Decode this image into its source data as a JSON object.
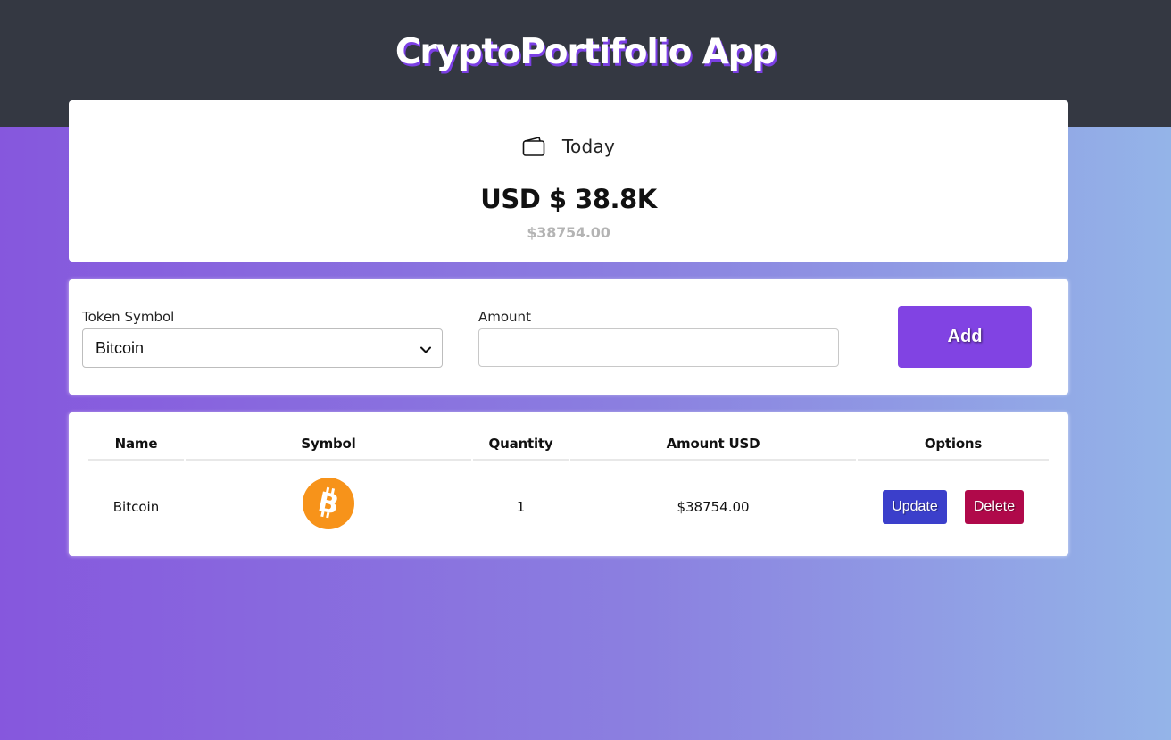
{
  "app": {
    "title": "CryptoPortifolio App"
  },
  "summary": {
    "period_label": "Today",
    "total_short": "USD $ 38.8K",
    "total_exact": "$38754.00",
    "icon": "wallet-icon"
  },
  "form": {
    "token_label": "Token Symbol",
    "token_selected": "Bitcoin",
    "amount_label": "Amount",
    "amount_value": "",
    "add_label": "Add"
  },
  "table": {
    "headers": [
      "Name",
      "Symbol",
      "Quantity",
      "Amount USD",
      "Options"
    ],
    "rows": [
      {
        "name": "Bitcoin",
        "symbol_icon": "bitcoin-icon",
        "quantity": "1",
        "amount_usd": "$38754.00",
        "update_label": "Update",
        "delete_label": "Delete"
      }
    ]
  },
  "colors": {
    "header_bg": "#343842",
    "accent": "#8143e3",
    "update": "#3b3fcb",
    "delete": "#b0094a",
    "bitcoin": "#f7931a",
    "gradient_start": "#8657dd",
    "gradient_end": "#94b4e8"
  }
}
